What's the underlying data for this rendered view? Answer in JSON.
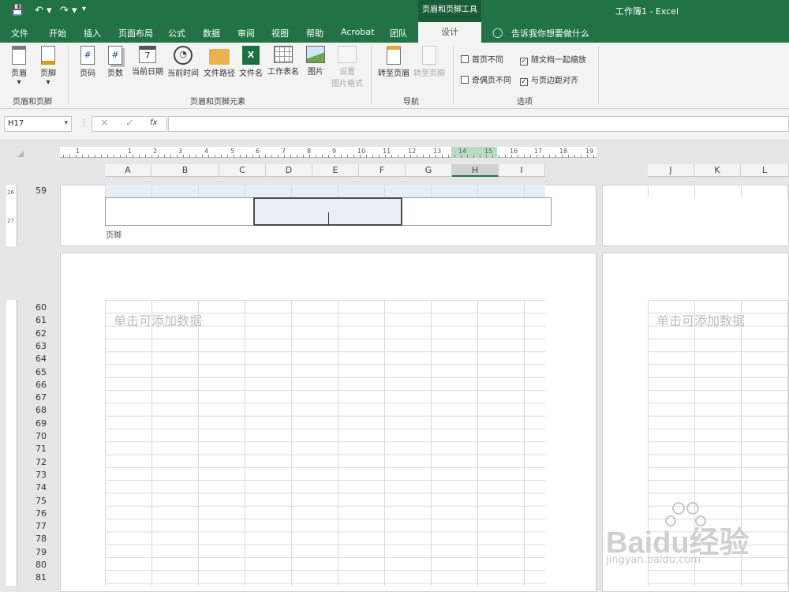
{
  "title_bar": {
    "context_group": "页眉和页脚工具",
    "window_title": "工作簿1 - Excel"
  },
  "tabs": [
    "文件",
    "开始",
    "插入",
    "页面布局",
    "公式",
    "数据",
    "审阅",
    "视图",
    "帮助",
    "Acrobat",
    "团队",
    "设计"
  ],
  "tell_me": "告诉我你想要做什么",
  "ribbon": {
    "header": "页眉",
    "footer": "页脚",
    "group1": "页眉和页脚",
    "page_number": "页码",
    "page_count": "页数",
    "current_date": "当前日期",
    "current_time": "当前时间",
    "file_path": "文件路径",
    "file_name": "文件名",
    "sheet_name": "工作表名",
    "picture": "图片",
    "format_picture_1": "设置",
    "format_picture_2": "图片格式",
    "group2": "页眉和页脚元素",
    "goto_header": "转至页眉",
    "goto_footer": "转至页脚",
    "group3": "导航",
    "diff_first": "首页不同",
    "diff_odd_even": "奇偶页不同",
    "scale_with_doc": "随文档一起缩放",
    "align_margins": "与页边距对齐",
    "group4": "选项",
    "diff_first_checked": false,
    "diff_odd_even_checked": false,
    "scale_with_doc_checked": true,
    "align_margins_checked": true
  },
  "formula_bar": {
    "name_box": "H17",
    "fx": "fx",
    "value": ""
  },
  "ruler": [
    "1",
    "1",
    "2",
    "3",
    "4",
    "5",
    "6",
    "7",
    "8",
    "9",
    "10",
    "11",
    "12",
    "13",
    "14",
    "15",
    "16",
    "17",
    "18",
    "19"
  ],
  "columns": [
    "A",
    "B",
    "C",
    "D",
    "E",
    "F",
    "G",
    "H",
    "I",
    "J",
    "K",
    "L"
  ],
  "rows": [
    "59",
    "60",
    "61",
    "62",
    "63",
    "64",
    "65",
    "66",
    "67",
    "68",
    "69",
    "70",
    "71",
    "72",
    "73",
    "74",
    "75",
    "76",
    "77",
    "78",
    "79",
    "80",
    "81"
  ],
  "vertical_ruler": [
    "26",
    "27"
  ],
  "footer_label": "页脚",
  "placeholder": "单击可添加数据",
  "watermark": {
    "brand": "Baidu经验",
    "url": "jingyan.baidu.com"
  }
}
